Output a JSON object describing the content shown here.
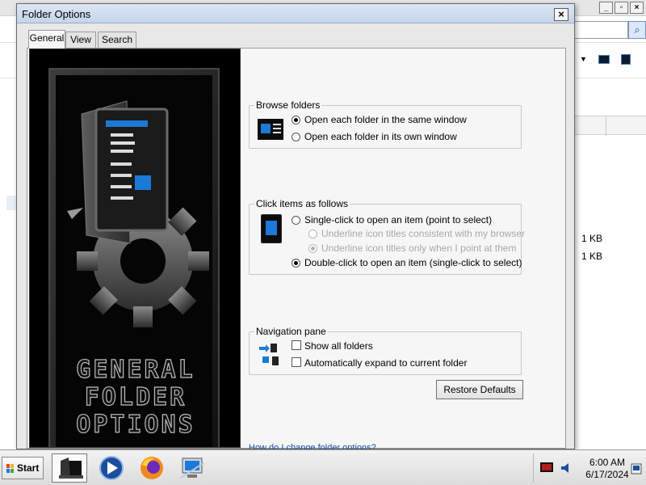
{
  "background_window": {
    "file_sizes": [
      "1 KB",
      "1 KB"
    ]
  },
  "dialog": {
    "title": "Folder Options",
    "tabs": [
      {
        "label": "General",
        "active": true
      },
      {
        "label": "View",
        "active": false
      },
      {
        "label": "Search",
        "active": false
      }
    ],
    "artwork_text": [
      "GENERAL",
      "FOLDER",
      "OPTIONS"
    ],
    "browse_folders": {
      "label": "Browse folders",
      "options": [
        {
          "label": "Open each folder in the same window",
          "checked": true
        },
        {
          "label": "Open each folder in its own window",
          "checked": false
        }
      ]
    },
    "click_items": {
      "label": "Click items as follows",
      "single_click": {
        "label": "Single-click to open an item (point to select)",
        "checked": false
      },
      "underline_consistent": {
        "label": "Underline icon titles consistent with my browser",
        "checked": false,
        "disabled": true
      },
      "underline_point": {
        "label": "Underline icon titles only when I point at them",
        "checked": true,
        "disabled": true
      },
      "double_click": {
        "label": "Double-click to open an item (single-click to select)",
        "checked": true
      }
    },
    "navigation_pane": {
      "label": "Navigation pane",
      "show_all_folders": {
        "label": "Show all folders",
        "checked": false
      },
      "auto_expand": {
        "label": "Automatically expand to current folder",
        "checked": false
      }
    },
    "restore_defaults_label": "Restore Defaults",
    "help_link": "How do I change folder options?"
  },
  "taskbar": {
    "start_label": "Start",
    "clock_time": "6:00 AM",
    "clock_date": "6/17/2024"
  },
  "colors": {
    "accent": "#1a4fa6",
    "dialog_bg": "#f6f6f6",
    "artwork_bg": "#000000"
  }
}
